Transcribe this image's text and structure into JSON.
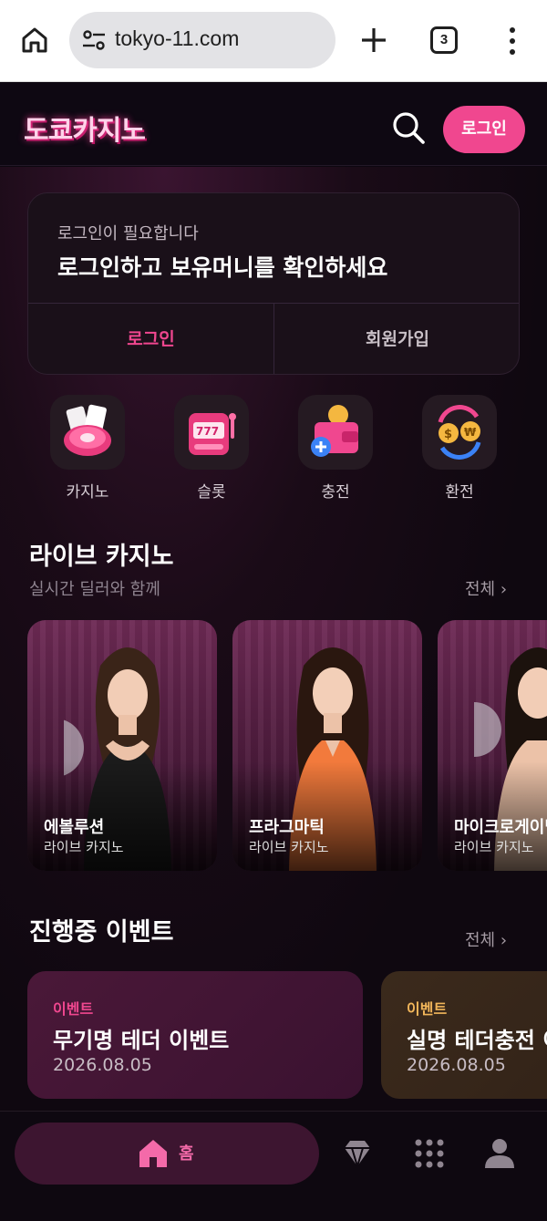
{
  "browser": {
    "url": "tokyo-11.com",
    "tab_count": "3"
  },
  "header": {
    "logo_text": "도쿄카지노",
    "login_button": "로그인"
  },
  "login_card": {
    "subtitle": "로그인이 필요합니다",
    "title": "로그인하고 보유머니를 확인하세요",
    "login_button": "로그인",
    "join_button": "회원가입"
  },
  "quick_menu": [
    {
      "label": "카지노",
      "icon": "roulette-cards-icon"
    },
    {
      "label": "슬롯",
      "icon": "slot-machine-icon"
    },
    {
      "label": "충전",
      "icon": "wallet-plus-icon"
    },
    {
      "label": "환전",
      "icon": "currency-exchange-icon"
    }
  ],
  "live_casino": {
    "title": "라이브 카지노",
    "subtitle": "실시간 딜러와 함께",
    "see_all": "전체 ›",
    "cards": [
      {
        "name": "에볼루션",
        "type": "라이브 카지노"
      },
      {
        "name": "프라그마틱",
        "type": "라이브 카지노"
      },
      {
        "name": "마이크로게이밍",
        "type": "라이브 카지노"
      }
    ]
  },
  "events": {
    "title": "진행중 이벤트",
    "see_all": "전체 ›",
    "items": [
      {
        "tag": "이벤트",
        "title": "무기명 테더 이벤트",
        "date": "2026.08.05",
        "tag_color": "#f0478f"
      },
      {
        "tag": "이벤트",
        "title": "실명 테더충전 이벤트",
        "date": "2026.08.05",
        "tag_color": "#f2b65a"
      }
    ]
  },
  "bottom_nav": {
    "home_label": "홈",
    "items": [
      "diamond-icon",
      "grid-icon",
      "user-icon"
    ]
  },
  "colors": {
    "accent": "#f0478f",
    "background": "#0d0710"
  }
}
